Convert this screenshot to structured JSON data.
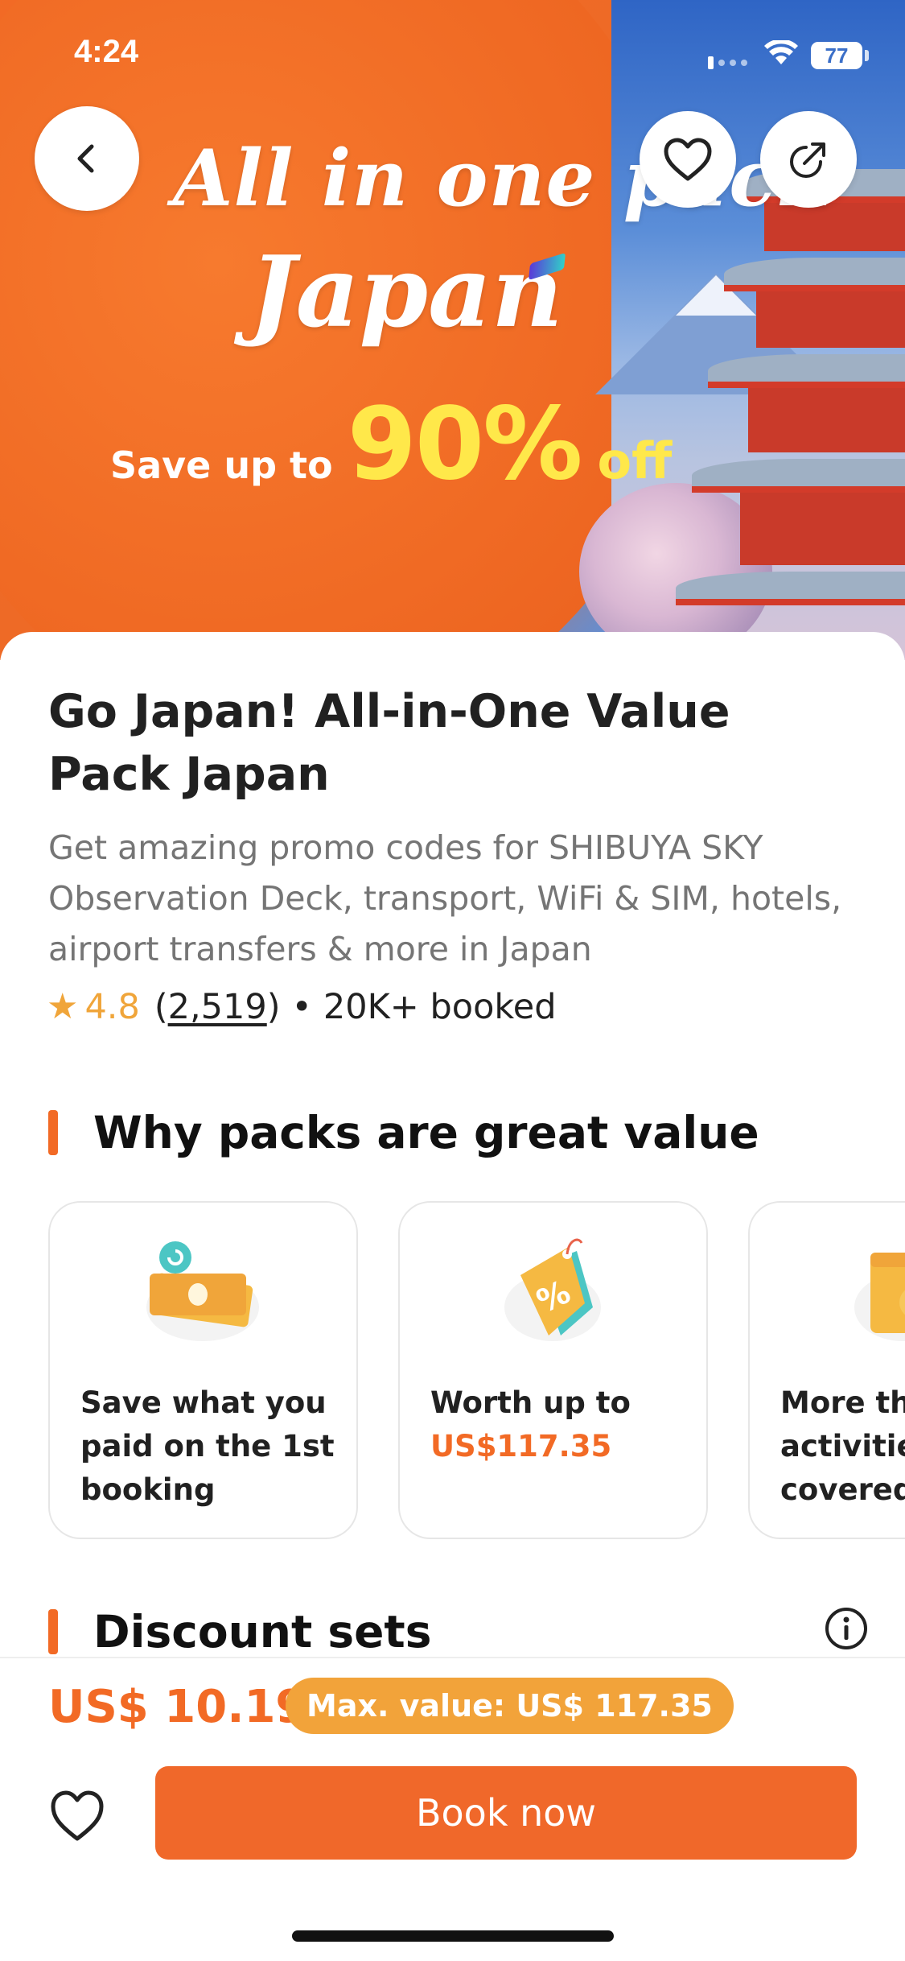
{
  "status_bar": {
    "time": "4:24",
    "battery": "77"
  },
  "hero": {
    "line1": "All in one pack",
    "line2": "Japan",
    "save_prefix": "Save up to",
    "save_percent": "90%",
    "save_suffix": "off",
    "colors": {
      "orange": "#f26a25",
      "yellow": "#ffe84a",
      "sky": "#3b6fc8"
    }
  },
  "header_buttons": {
    "back_icon": "chevron-left-icon",
    "favorite_icon": "heart-outline-icon",
    "share_icon": "share-icon"
  },
  "product": {
    "title": "Go Japan! All-in-One Value Pack Japan",
    "description": "Get amazing promo codes for SHIBUYA SKY Observation Deck, transport, WiFi & SIM, hotels, airport transfers & more in Japan",
    "rating": "4.8",
    "reviews_open": "(",
    "reviews": "2,519",
    "reviews_close": ")",
    "separator": "•",
    "booked": "20K+ booked"
  },
  "why_section": {
    "title": "Why packs are great value",
    "cards": [
      {
        "icon": "money-refund-icon",
        "text": "Save what you paid on the 1st booking",
        "accent": ""
      },
      {
        "icon": "discount-tag-icon",
        "text": "Worth up to",
        "accent": "US$117.35"
      },
      {
        "icon": "ticket-calendar-icon",
        "text": "More than top activities covered",
        "accent": ""
      }
    ]
  },
  "discount_section": {
    "title": "Discount sets",
    "info_icon": "info-icon"
  },
  "bottom_bar": {
    "price": "US$ 10.19",
    "max_value": "Max. value: US$ 117.35",
    "wishlist_icon": "heart-outline-icon",
    "book_label": "Book now",
    "accent": "#f0682a"
  }
}
